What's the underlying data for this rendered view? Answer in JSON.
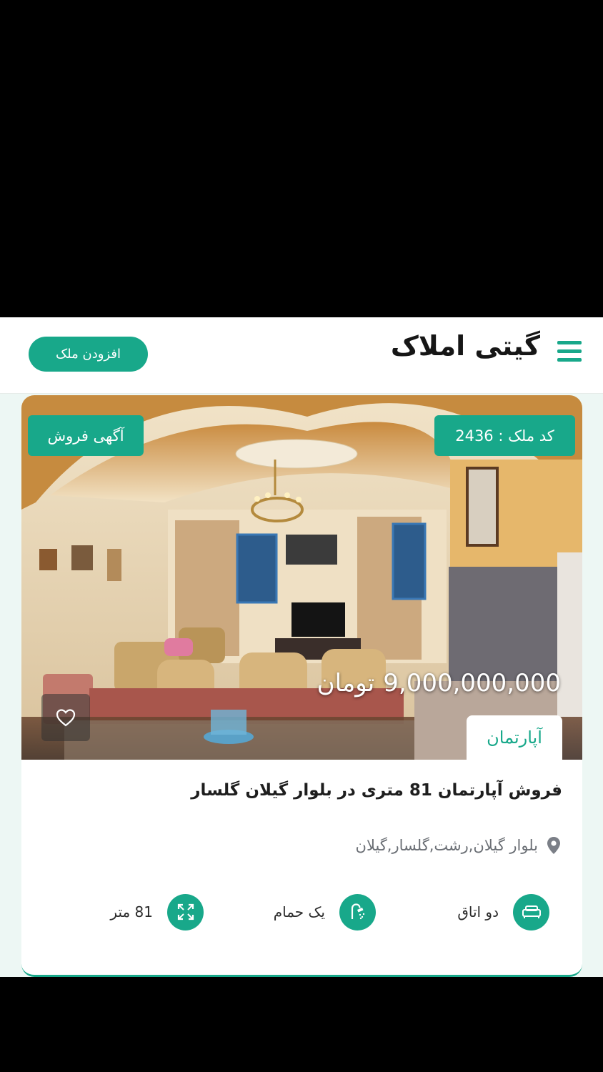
{
  "header": {
    "brand": "گیتی املاک",
    "add_button": "افزودن ملک",
    "menu_icon": "hamburger-icon"
  },
  "listing": {
    "code_label": "کد ملک : 2436",
    "sale_label": "آگهی فروش",
    "price_amount": "9,000,000,000",
    "price_unit": "تومان",
    "type": "آپارتمان",
    "title": "فروش آپارتمان 81 متری در بلوار گیلان گلسار",
    "location": "بلوار گیلان,رشت,گلسار,گیلان",
    "features": {
      "rooms": "دو اتاق",
      "baths": "یک حمام",
      "area": "81 متر"
    }
  },
  "colors": {
    "accent": "#18a88a",
    "page_bg": "#edf7f4"
  }
}
